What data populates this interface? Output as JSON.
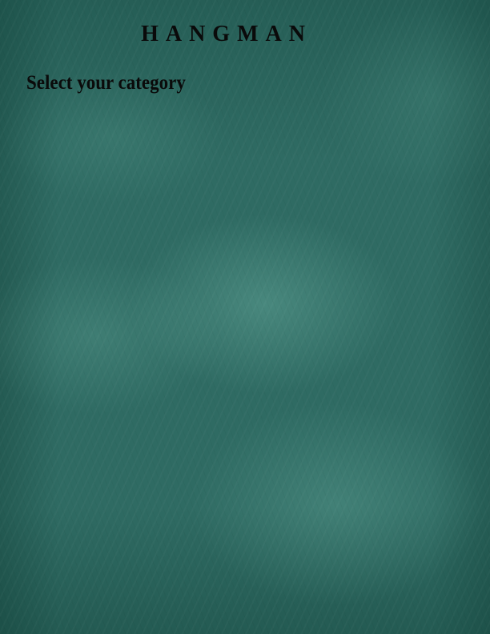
{
  "game": {
    "title": "HANGMAN",
    "prompt": "Select your category"
  },
  "categories": [],
  "colors": {
    "board": "#2f6b63",
    "text": "#0a0a0a"
  }
}
